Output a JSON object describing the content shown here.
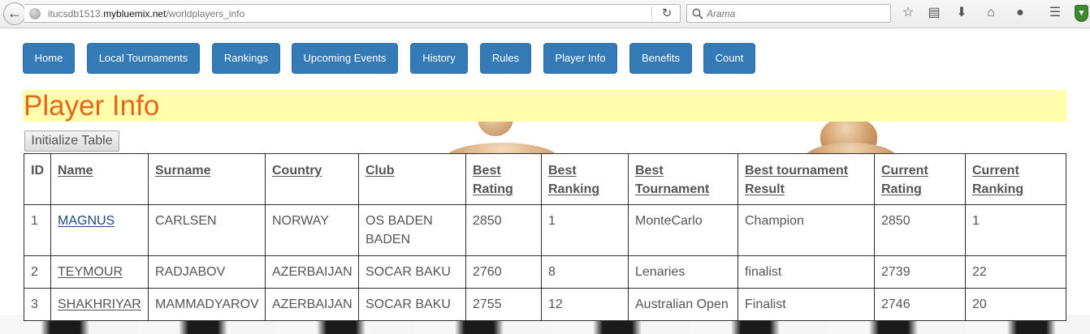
{
  "browser": {
    "url_prefix": "itucsdb1513.",
    "url_host": "mybluemix.net",
    "url_path": "/worldplayers_info",
    "search_placeholder": "Arama"
  },
  "nav": [
    "Home",
    "Local Tournaments",
    "Rankings",
    "Upcoming Events",
    "History",
    "Rules",
    "Player Info",
    "Benefits",
    "Count"
  ],
  "page": {
    "title": "Player Info",
    "init_button": "Initialize Table"
  },
  "table": {
    "headers": [
      "ID",
      "Name",
      "Surname",
      "Country",
      "Club",
      "Best Rating",
      "Best Ranking",
      "Best Tournament",
      "Best tournament Result",
      "Current Rating",
      "Current Ranking"
    ],
    "rows": [
      [
        "1",
        "MAGNUS",
        "CARLSEN",
        "NORWAY",
        "OS BADEN BADEN",
        "2850",
        "1",
        "MonteCarlo",
        "Champion",
        "2850",
        "1"
      ],
      [
        "2",
        "TEYMOUR",
        "RADJABOV",
        "AZERBAIJAN",
        "SOCAR BAKU",
        "2760",
        "8",
        "Lenaries",
        "finalist",
        "2739",
        "22"
      ],
      [
        "3",
        "SHAKHRIYAR",
        "MAMMADYAROV",
        "AZERBAIJAN",
        "SOCAR BAKU",
        "2755",
        "12",
        "Australian Open",
        "Finalist",
        "2746",
        "20"
      ]
    ]
  },
  "colors": {
    "nav_button_bg": "#337ab7",
    "heading_text": "#e8631b",
    "heading_bg": "#ffffab"
  }
}
